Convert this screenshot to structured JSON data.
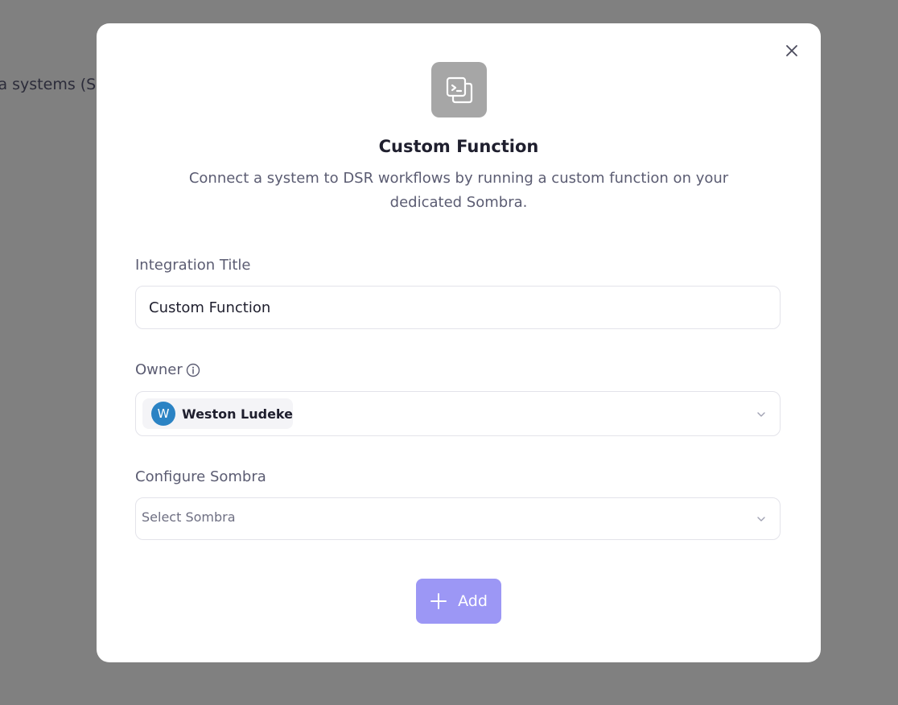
{
  "background": {
    "partial_text": "ta systems (S"
  },
  "modal": {
    "close_icon": "close-icon",
    "hero_icon": "terminal-icon",
    "title": "Custom Function",
    "description": "Connect a system to DSR workflows by running a custom function on your dedicated Sombra.",
    "integration_title": {
      "label": "Integration Title",
      "value": "Custom Function"
    },
    "owner": {
      "label": "Owner",
      "info_icon": "info-icon",
      "selected": {
        "initial": "W",
        "name": "Weston Ludeke",
        "avatar_color": "#2b83c4"
      }
    },
    "sombra": {
      "label": "Configure Sombra",
      "placeholder": "Select Sombra"
    },
    "add_button": {
      "label": "Add",
      "icon": "plus-icon",
      "color": "#9c97f5"
    }
  }
}
